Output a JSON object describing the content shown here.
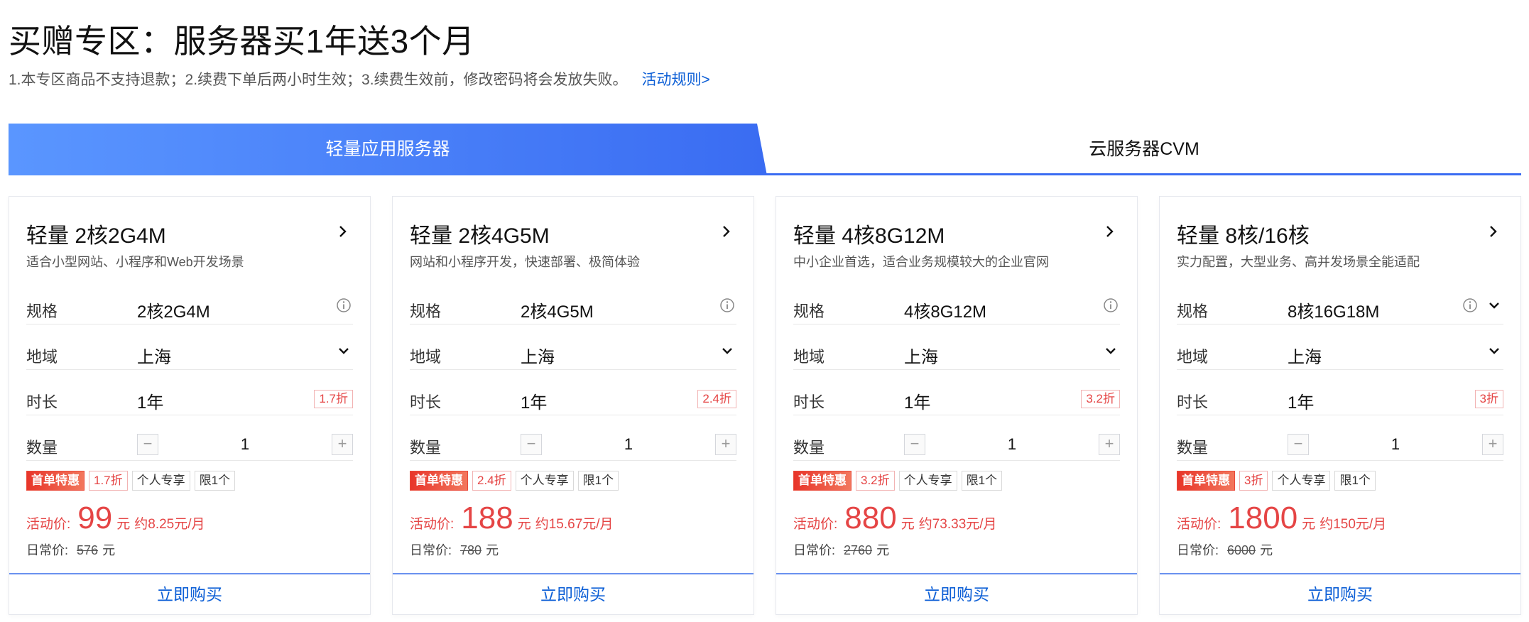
{
  "page": {
    "title": "买赠专区：服务器买1年送3个月",
    "notice": "1.本专区商品不支持退款；2.续费下单后两小时生效；3.续费生效前，修改密码将会发放失败。",
    "rules_link": "活动规则>"
  },
  "tabs": [
    {
      "label": "轻量应用服务器",
      "active": true
    },
    {
      "label": "云服务器CVM",
      "active": false
    }
  ],
  "labels": {
    "spec": "规格",
    "region": "地域",
    "duration": "时长",
    "quantity": "数量",
    "minus": "−",
    "plus": "+",
    "activity_price": "活动价:",
    "normal_price": "日常价:",
    "currency_unit": "元",
    "buy": "立即购买"
  },
  "colors": {
    "accent": "#3a6cf2",
    "price_red": "#e54545",
    "link_blue": "#0d5fd6"
  },
  "cards": [
    {
      "title": "轻量 2核2G4M",
      "subtitle": "适合小型网站、小程序和Web开发场景",
      "spec": "2核2G4M",
      "region": "上海",
      "duration": "1年",
      "discount": "1.7折",
      "quantity": "1",
      "tags": [
        "首单特惠",
        "1.7折",
        "个人专享",
        "限1个"
      ],
      "price": "99",
      "monthly": "约8.25元/月",
      "normal_price": "576"
    },
    {
      "title": "轻量 2核4G5M",
      "subtitle": "网站和小程序开发，快速部署、极简体验",
      "spec": "2核4G5M",
      "region": "上海",
      "duration": "1年",
      "discount": "2.4折",
      "quantity": "1",
      "tags": [
        "首单特惠",
        "2.4折",
        "个人专享",
        "限1个"
      ],
      "price": "188",
      "monthly": "约15.67元/月",
      "normal_price": "780"
    },
    {
      "title": "轻量 4核8G12M",
      "subtitle": "中小企业首选，适合业务规模较大的企业官网",
      "spec": "4核8G12M",
      "region": "上海",
      "duration": "1年",
      "discount": "3.2折",
      "quantity": "1",
      "tags": [
        "首单特惠",
        "3.2折",
        "个人专享",
        "限1个"
      ],
      "price": "880",
      "monthly": "约73.33元/月",
      "normal_price": "2760"
    },
    {
      "title": "轻量 8核/16核",
      "subtitle": "实力配置，大型业务、高并发场景全能适配",
      "spec": "8核16G18M",
      "region": "上海",
      "duration": "1年",
      "discount": "3折",
      "quantity": "1",
      "tags": [
        "首单特惠",
        "3折",
        "个人专享",
        "限1个"
      ],
      "price": "1800",
      "monthly": "约150元/月",
      "normal_price": "6000"
    }
  ]
}
